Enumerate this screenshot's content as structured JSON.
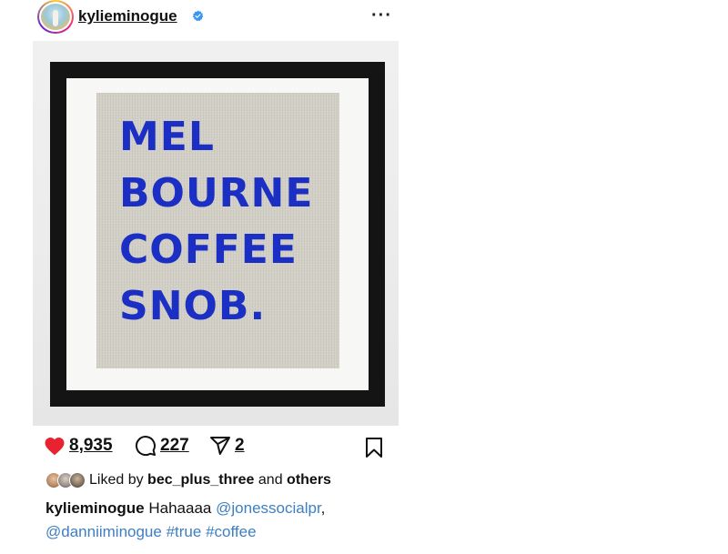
{
  "header": {
    "username": "kylieminogue",
    "verified_icon": "verified-badge-icon",
    "more_icon": "more-options-icon"
  },
  "artwork": {
    "lines": [
      "MEL",
      "BOURNE",
      "COFFEE",
      "SNOB."
    ],
    "text_color": "#1b2fc4"
  },
  "actions": {
    "likes": "8,935",
    "comments": "227",
    "shares": "2",
    "like_color": "#e8222f"
  },
  "liked_by": {
    "prefix": "Liked by",
    "user": "bec_plus_three",
    "conjunction": "and",
    "others": "others"
  },
  "caption": {
    "username": "kylieminogue",
    "text": "Hahaaaa",
    "mention1": "@jonessocialpr",
    "separator": ",",
    "mention2": "@danniiminogue",
    "hashtag1": "#true",
    "hashtag2": "#coffee",
    "link_color": "#3d7fc4"
  }
}
